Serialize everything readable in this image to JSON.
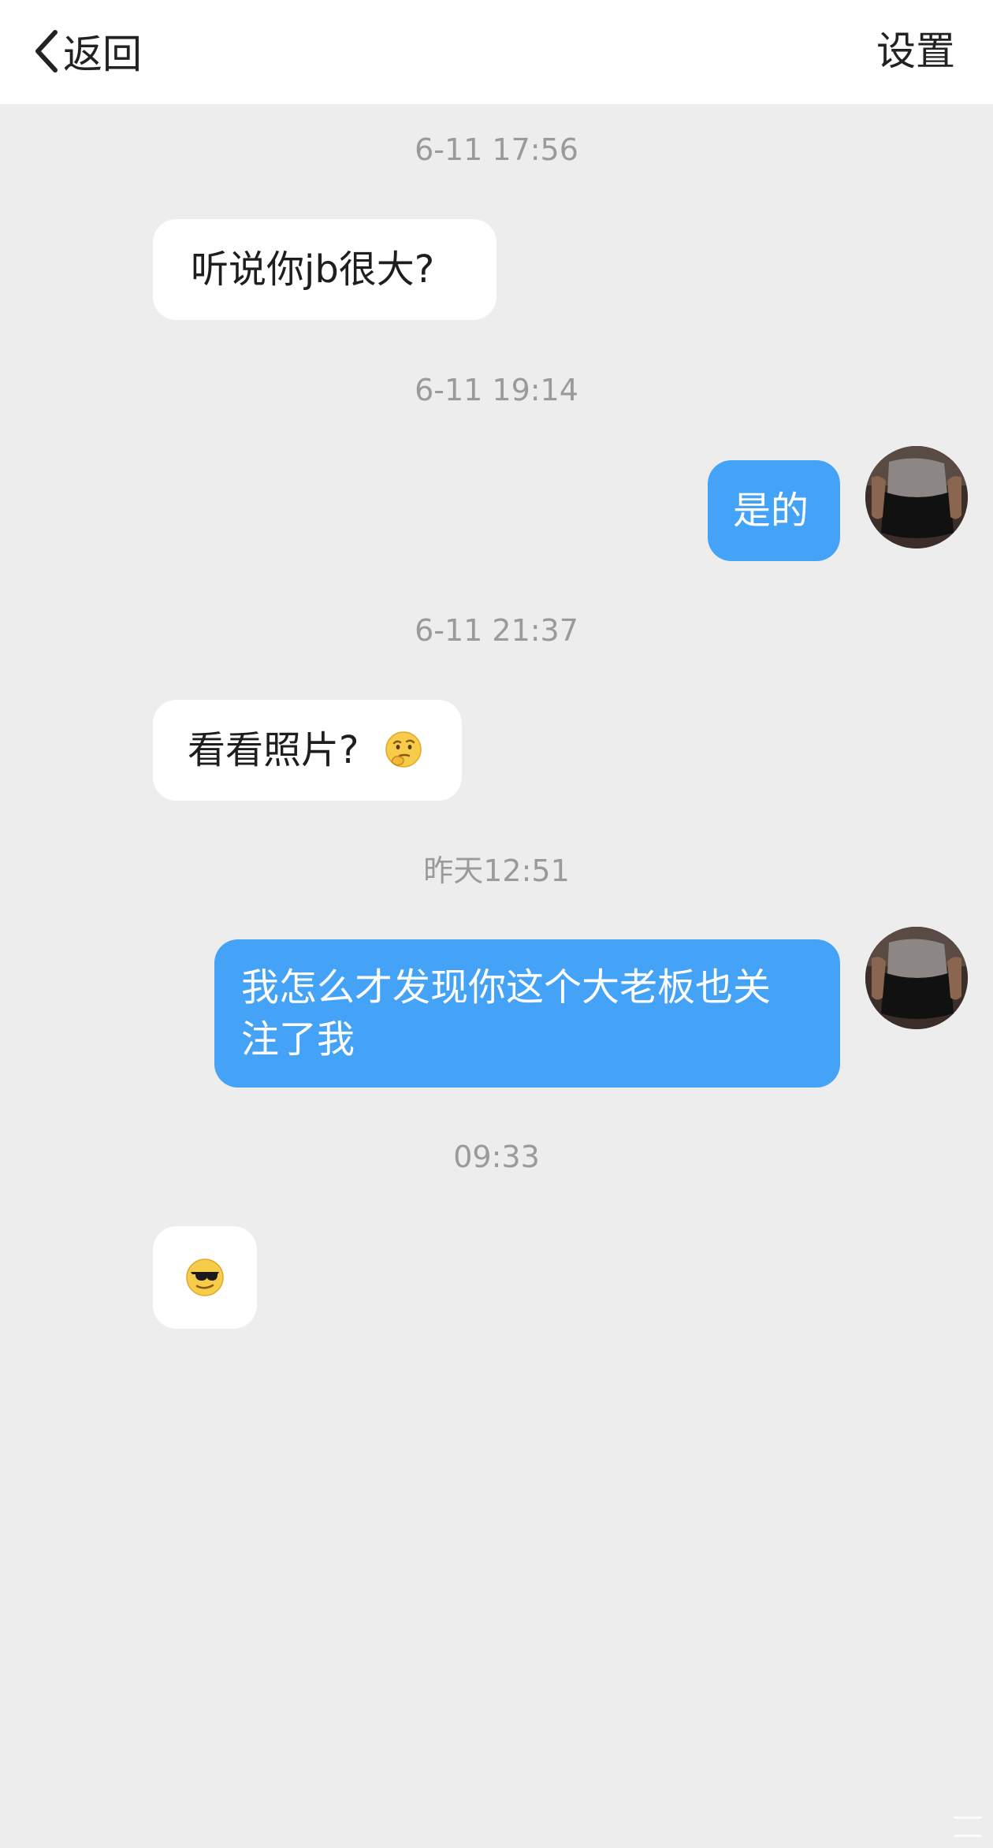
{
  "header": {
    "back_label": "返回",
    "settings_label": "设置"
  },
  "messages": [
    {
      "timestamp": "6-11 17:56",
      "direction": "incoming",
      "text": "听说你jb很大?"
    },
    {
      "timestamp": "6-11 19:14",
      "direction": "outgoing",
      "text": "是的"
    },
    {
      "timestamp": "6-11 21:37",
      "direction": "incoming",
      "text": "看看照片?",
      "emoji": "thinking-face-icon"
    },
    {
      "timestamp": "昨天12:51",
      "direction": "outgoing",
      "text_line1": "我怎么才发现你这个大老板也关",
      "text_line2": "注了我"
    },
    {
      "timestamp": "09:33",
      "direction": "incoming",
      "emoji": "sunglasses-face-icon"
    }
  ],
  "colors": {
    "outgoing_bubble": "#44a3f6",
    "incoming_bubble": "#ffffff",
    "background": "#ededed",
    "timestamp_text": "#9a9a9a"
  }
}
